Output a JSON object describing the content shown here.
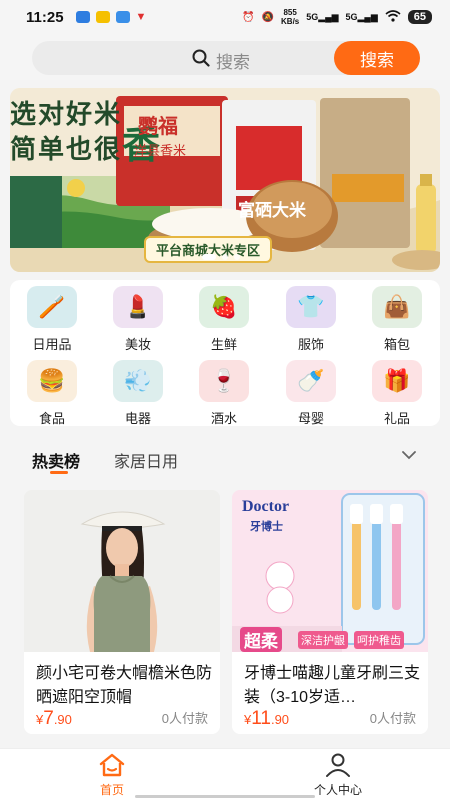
{
  "status_bar": {
    "time": "11:25",
    "net_speed_value": "855",
    "net_speed_unit": "KB/s",
    "signal_1": "5G",
    "signal_2": "5G",
    "battery": "65"
  },
  "search": {
    "placeholder": "搜索",
    "button_label": "搜索"
  },
  "banner": {
    "slogan_line1": "选对好米",
    "slogan_line2": "简单也很",
    "slogan_accent": "香",
    "brand_1": "鹦福",
    "brand_1_sub": "洋县香米",
    "brand_2": "富硒大米",
    "caption": "平台商城大米专区"
  },
  "categories": [
    {
      "label": "日用品",
      "icon": "toothbrush-cup-icon",
      "bg": "#d7ecef",
      "glyph": "🪥"
    },
    {
      "label": "美妆",
      "icon": "lipstick-icon",
      "bg": "#efe2f2",
      "glyph": "💄"
    },
    {
      "label": "生鲜",
      "icon": "strawberry-icon",
      "bg": "#dff0e2",
      "glyph": "🍓"
    },
    {
      "label": "服饰",
      "icon": "tshirt-icon",
      "bg": "#e6dcf4",
      "glyph": "👕"
    },
    {
      "label": "箱包",
      "icon": "bag-icon",
      "bg": "#e3efe2",
      "glyph": "👜"
    },
    {
      "label": "食品",
      "icon": "burger-icon",
      "bg": "#faeedd",
      "glyph": "🍔"
    },
    {
      "label": "电器",
      "icon": "hairdryer-icon",
      "bg": "#ddeeed",
      "glyph": "💨"
    },
    {
      "label": "酒水",
      "icon": "wine-icon",
      "bg": "#fbe1e1",
      "glyph": "🍷"
    },
    {
      "label": "母婴",
      "icon": "baby-bottle-icon",
      "bg": "#fbe6ea",
      "glyph": "🍼"
    },
    {
      "label": "礼品",
      "icon": "gift-icon",
      "bg": "#fde2e4",
      "glyph": "🎁"
    }
  ],
  "tabs": [
    {
      "label": "热卖榜",
      "active": true
    },
    {
      "label": "家居日用",
      "active": false
    }
  ],
  "products": [
    {
      "title": "颜小宅可卷大帽檐米色防晒遮阳空顶帽",
      "currency": "¥",
      "price_int": "7",
      "price_dec": ".90",
      "sold": "0人付款"
    },
    {
      "title": "牙博士喵趣儿童牙刷三支装（3-10岁适…",
      "currency": "¥",
      "price_int": "11",
      "price_dec": ".90",
      "sold": "0人付款",
      "img_brand": "Doctor",
      "img_brand_cn": "牙博士",
      "img_badge_1": "超柔",
      "img_badge_2": "深洁护龈",
      "img_badge_3": "呵护稚齿"
    }
  ],
  "bottom_nav": [
    {
      "label": "首页",
      "icon": "home-icon",
      "active": true
    },
    {
      "label": "个人中心",
      "icon": "user-icon",
      "active": false
    }
  ],
  "colors": {
    "accent": "#ff6a14",
    "price": "#ff4d1a"
  }
}
